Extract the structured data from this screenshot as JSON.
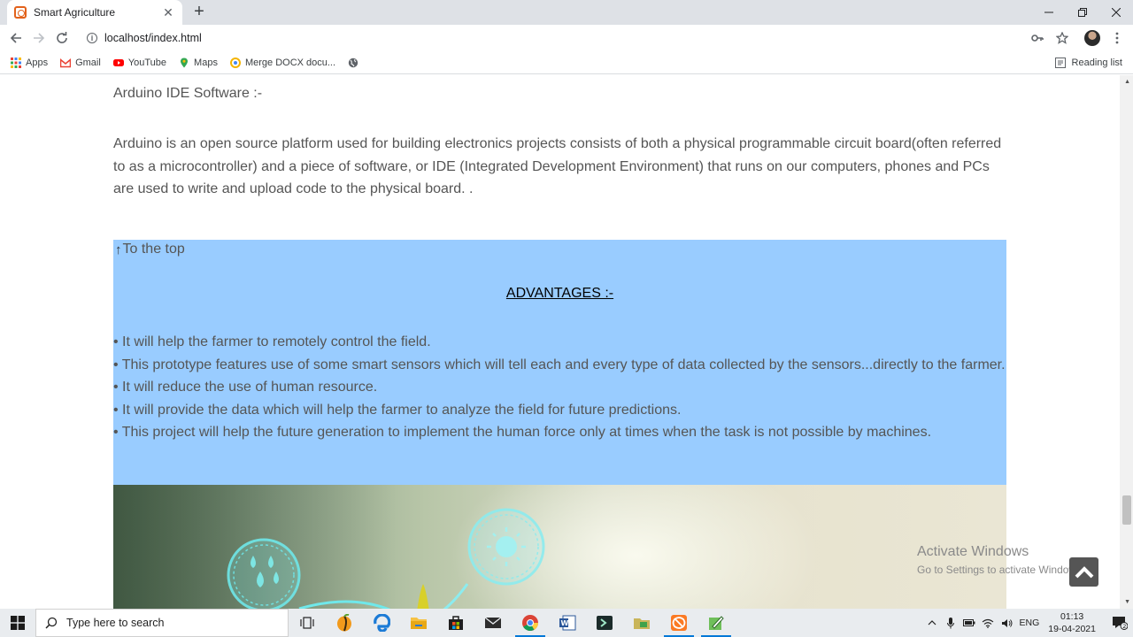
{
  "browser": {
    "tab_title": "Smart Agriculture",
    "tab_close": "✕",
    "new_tab": "+",
    "url": "localhost/index.html",
    "reading_list": "Reading list",
    "bookmarks": [
      {
        "label": "Apps",
        "icon": "apps-grid-icon"
      },
      {
        "label": "Gmail",
        "icon": "gmail-icon"
      },
      {
        "label": "YouTube",
        "icon": "youtube-icon"
      },
      {
        "label": "Maps",
        "icon": "maps-pin-icon"
      },
      {
        "label": "Merge DOCX docu...",
        "icon": "merge-docx-icon"
      }
    ]
  },
  "page": {
    "section_title": "Arduino IDE Software :-",
    "paragraph": "Arduino is an open source platform used for building electronics projects consists of both a physical programmable circuit board(often referred to as a microcontroller) and a piece of software, or IDE (Integrated Development Environment) that runs on our computers, phones and PCs are used to write and upload code to the physical board. .",
    "to_top_arrow": "↑",
    "to_top": "To the top",
    "advantages_title": "ADVANTAGES :-",
    "advantages": [
      "• It will help the farmer to remotely control the field.",
      "• This prototype features use of some smart sensors which will tell each and every type of data collected by the sensors...directly to the farmer.",
      "• It will reduce the use of human resource.",
      "• It will provide the data which will help the farmer to analyze the field for future predictions.",
      "• This project will help the future generation to implement the human force only at times when the task is not possible by machines."
    ],
    "advantages_bg": "#99ccff"
  },
  "watermark": {
    "line1": "Activate Windows",
    "line2": "Go to Settings to activate Windows."
  },
  "taskbar": {
    "search_placeholder": "Type here to search",
    "language": "ENG",
    "time": "01:13",
    "date": "19-04-2021",
    "notification_count": "2"
  }
}
